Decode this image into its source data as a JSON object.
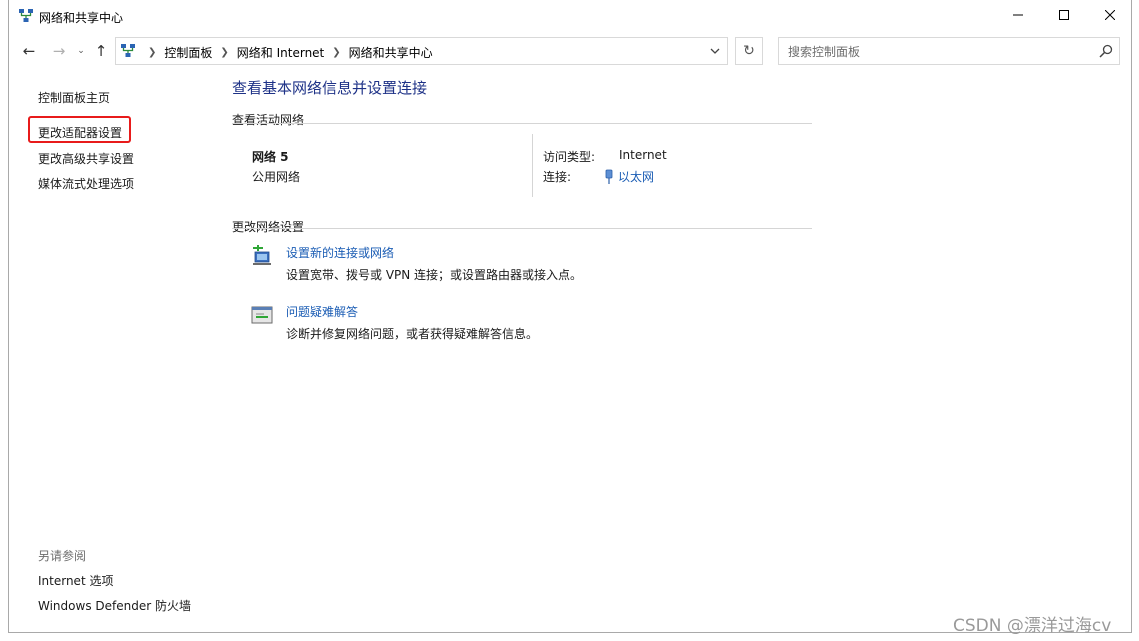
{
  "window": {
    "title": "网络和共享中心"
  },
  "nav": {
    "back": "←",
    "forward": "→",
    "recent": "⌄",
    "up": "↑",
    "breadcrumbs": [
      "控制面板",
      "网络和 Internet",
      "网络和共享中心"
    ],
    "refresh": "↻",
    "search_placeholder": "搜索控制面板"
  },
  "sidebar": {
    "items": [
      {
        "label": "控制面板主页"
      },
      {
        "label": "更改适配器设置"
      },
      {
        "label": "更改高级共享设置"
      },
      {
        "label": "媒体流式处理选项"
      }
    ],
    "see_also_heading": "另请参阅",
    "see_also": [
      {
        "label": "Internet 选项"
      },
      {
        "label": "Windows Defender 防火墙"
      }
    ]
  },
  "main": {
    "title": "查看基本网络信息并设置连接",
    "active_heading": "查看活动网络",
    "network": {
      "name": "网络 5",
      "type": "公用网络",
      "access_label": "访问类型:",
      "access_value": "Internet",
      "connection_label": "连接:",
      "connection_value": "以太网"
    },
    "change_heading": "更改网络设置",
    "tasks": [
      {
        "label": "设置新的连接或网络",
        "desc": "设置宽带、拨号或 VPN 连接；或设置路由器或接入点。",
        "icon": "new-connection-icon"
      },
      {
        "label": "问题疑难解答",
        "desc": "诊断并修复网络问题，或者获得疑难解答信息。",
        "icon": "troubleshoot-icon"
      }
    ]
  },
  "watermark": "CSDN @漂洋过海cv",
  "colors": {
    "link": "#1a5cb4",
    "title": "#1e3287",
    "highlight": "#e81b1b"
  }
}
